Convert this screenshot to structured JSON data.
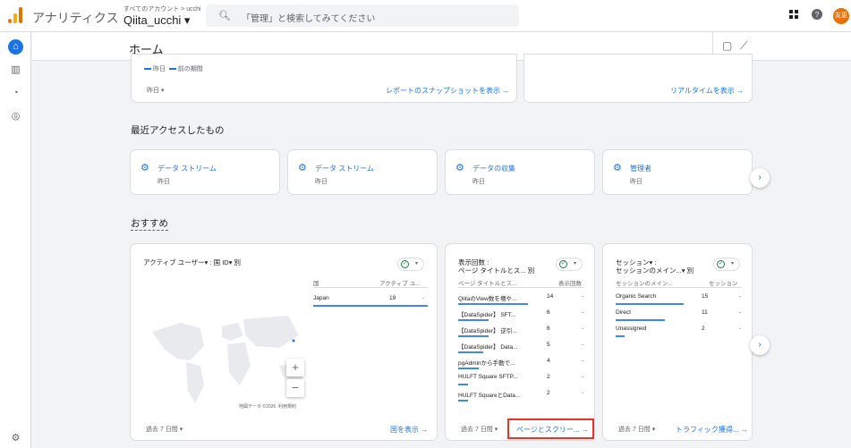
{
  "topbar": {
    "app_title": "アナリティクス",
    "account_path": "すべてのアカウント > ucchi",
    "property_name": "Qiita_ucchi ▾",
    "search_placeholder": "「管理」と検索してみてください",
    "avatar_text": "友恵",
    "icons": [
      "search-icon",
      "apps-icon",
      "help-icon"
    ]
  },
  "header": {
    "title": "ホーム"
  },
  "top_cards": {
    "legend_current": "昨日",
    "legend_previous": "前の期間",
    "left_range": "昨日",
    "left_link": "レポートのスナップショットを表示",
    "right_link": "リアルタイムを表示"
  },
  "recent": {
    "title": "最近アクセスしたもの",
    "items": [
      {
        "label": "データ ストリーム",
        "sub": "昨日"
      },
      {
        "label": "データ ストリーム",
        "sub": "昨日"
      },
      {
        "label": "データの収集",
        "sub": "昨日"
      },
      {
        "label": "管理者",
        "sub": "昨日"
      }
    ]
  },
  "recommend": {
    "title": "おすすめ",
    "users_card": {
      "title": "アクティブ ユーザー▾ : 国 ID▾ 別",
      "col1": "国",
      "col2": "アクティブ ユ...",
      "rows": [
        {
          "name": "Japan",
          "value": "19",
          "share": 1.0
        }
      ],
      "map_credit": "地図データ ©2026",
      "map_terms": "利用規約",
      "zoom_in": "+",
      "zoom_out": "−",
      "range": "過去 7 日間",
      "link": "国を表示"
    },
    "views_card": {
      "title1": "表示回数 :",
      "title2": "ページ タイトルとス... 別",
      "col1": "ページ タイトルとス...",
      "col2": "表示回数",
      "rows": [
        {
          "name": "QiitaのView数を増や...",
          "value": "14",
          "share": 1.0
        },
        {
          "name": "【DataSpider】 SFT...",
          "value": "6",
          "share": 0.43
        },
        {
          "name": "【DataSpider】 逆引...",
          "value": "6",
          "share": 0.43
        },
        {
          "name": "【DataSpider】 Data...",
          "value": "5",
          "share": 0.36
        },
        {
          "name": "pgAdminから手動で...",
          "value": "4",
          "share": 0.29
        },
        {
          "name": "HULFT Square SFTP...",
          "value": "2",
          "share": 0.14
        },
        {
          "name": "HULFT SquareとData...",
          "value": "2",
          "share": 0.14
        }
      ],
      "range": "過去 7 日間",
      "link": "ページとスクリー..."
    },
    "sessions_card": {
      "title1": "セッション▾ :",
      "title2": "セッションのメイン...▾ 別",
      "col1": "セッションのメイン...",
      "col2": "セッション",
      "rows": [
        {
          "name": "Organic Search",
          "value": "15",
          "share": 1.0
        },
        {
          "name": "Direct",
          "value": "11",
          "share": 0.73
        },
        {
          "name": "Unassigned",
          "value": "2",
          "share": 0.13
        }
      ],
      "range": "過去 7 日間",
      "link": "トラフィック獲得..."
    }
  },
  "colors": {
    "accent": "#1a73e8",
    "highlight": "#ea3323",
    "bar": "#4285f4"
  }
}
